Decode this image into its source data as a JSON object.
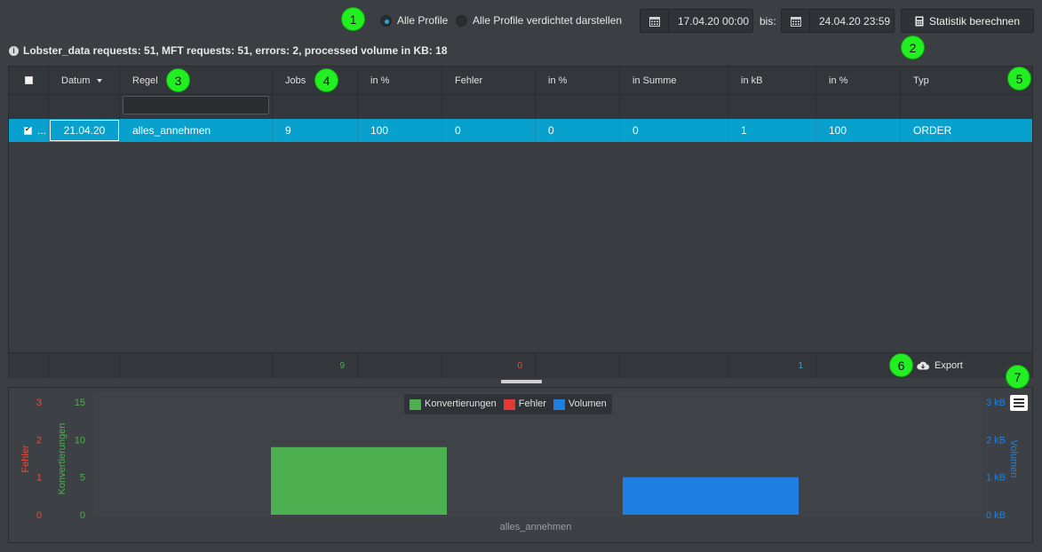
{
  "toolbar": {
    "radio_all": "Alle Profile",
    "radio_condensed": "Alle Profile verdichtet darstellen",
    "date_from": "17.04.20 00:00",
    "bis": "bis:",
    "date_to": "24.04.20 23:59",
    "calc_button": "Statistik berechnen"
  },
  "info_text": "Lobster_data requests: 51, MFT requests: 51, errors: 2, processed volume in KB: 18",
  "grid": {
    "columns": [
      "",
      "Datum",
      "Regel",
      "Jobs",
      "in %",
      "Fehler",
      "in %",
      "in Summe",
      "in kB",
      "in %",
      "Typ"
    ],
    "rows": [
      {
        "check": "...",
        "datum": "21.04.20",
        "regel": "alles_annehmen",
        "jobs": "9",
        "jobs_pct": "100",
        "fehler": "0",
        "fehler_pct": "0",
        "summe": "0",
        "kb": "1",
        "kb_pct": "100",
        "typ": "ORDER"
      }
    ],
    "footer": {
      "jobs": "9",
      "fehler": "0",
      "kb": "1"
    },
    "export": "Export"
  },
  "markers": [
    "1",
    "2",
    "3",
    "4",
    "5",
    "6",
    "7"
  ],
  "chart_data": {
    "type": "bar",
    "categories": [
      "alles_annehmen"
    ],
    "series": [
      {
        "name": "Konvertierungen",
        "values": [
          9
        ],
        "color": "#4caf50"
      },
      {
        "name": "Fehler",
        "values": [
          0
        ],
        "color": "#e53935"
      },
      {
        "name": "Volumen",
        "values": [
          1
        ],
        "color": "#1e7fe0"
      }
    ],
    "axes": {
      "fehler": {
        "label": "Fehler",
        "ticks": [
          "3",
          "2",
          "1",
          "0"
        ],
        "color": "#e84c3d"
      },
      "konvertierungen": {
        "label": "Konvertierungen",
        "ticks": [
          "15",
          "10",
          "5",
          "0"
        ],
        "color": "#4caf50"
      },
      "volumen": {
        "label": "Volumen",
        "ticks": [
          "3 kB",
          "2 kB",
          "1 kB",
          "0 kB"
        ],
        "color": "#1e7fe0"
      }
    },
    "ylim_konvertierungen": [
      0,
      15
    ],
    "ylim_volumen": [
      0,
      3
    ],
    "legend_position": "top-center"
  }
}
